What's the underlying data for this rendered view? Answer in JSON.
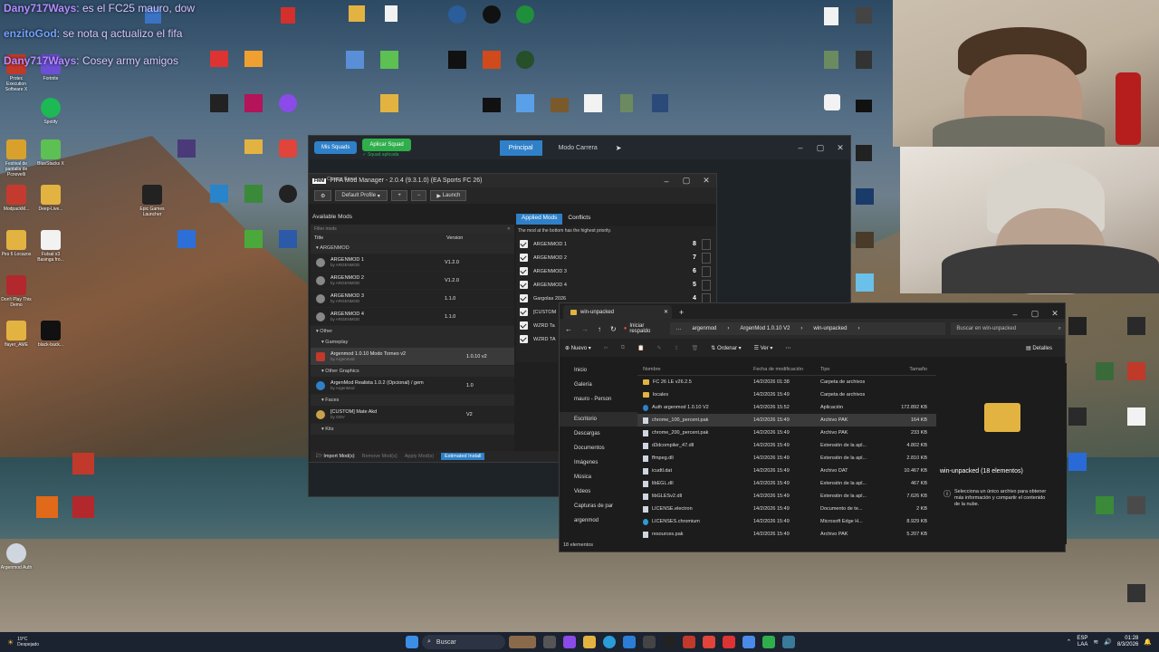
{
  "chat": [
    {
      "user": "Dany717Ways",
      "text": "es el FC25 mauro, dow"
    },
    {
      "user": "enzitoGod",
      "text": "se nota q actualizo el fifa"
    },
    {
      "user": "Dany717Ways",
      "text": "Cosey army amigos"
    }
  ],
  "desktop_icons": [
    {
      "label": "Protec Execution Software X"
    },
    {
      "label": "Fortnite"
    },
    {
      "label": "Spotify"
    },
    {
      "label": "Festival de pantalla de Pcnovelli"
    },
    {
      "label": "BlueStacks X"
    },
    {
      "label": "Epic Games Launcher"
    },
    {
      "label": "ModpackM..."
    },
    {
      "label": "Deep-Live..."
    },
    {
      "label": "Pes 6 Locazos"
    },
    {
      "label": "Futsal x3 Basinga fro..."
    },
    {
      "label": "Don't Play This Demo"
    },
    {
      "label": "flayer_AME"
    },
    {
      "label": "black-back..."
    },
    {
      "label": "Argenmod Auth"
    }
  ],
  "squad_window": {
    "my_squads": "Mis Squads",
    "apply_squad": "Aplicar Squad",
    "squad_applied": "✓ Squad aplicada",
    "tab_main": "Principal",
    "tab_career": "Modo Carrera"
  },
  "fmm": {
    "title": "FIFA Mod Manager - 2.0.4 (9.3.1.0) (EA Sports FC 26)",
    "change_game": "Change Game",
    "profile": "Default Profile",
    "launch": "Launch",
    "available_mods": "Available Mods",
    "filter_placeholder": "Filter mods",
    "col_title": "Title",
    "col_version": "Version",
    "groups": [
      {
        "name": "ARGENMOD",
        "mods": [
          {
            "name": "ARGENMOD 1",
            "by": "by ARGENMOD",
            "version": "V1.2.0"
          },
          {
            "name": "ARGENMOD 2",
            "by": "by ARGENMOD",
            "version": "V1.2.0"
          },
          {
            "name": "ARGENMOD 3",
            "by": "by ARGENMOD",
            "version": "1.1.0"
          },
          {
            "name": "ARGENMOD 4",
            "by": "by ARGENMOD",
            "version": "1.1.0"
          }
        ]
      },
      {
        "name": "Other",
        "mods": []
      },
      {
        "name": "Gameplay",
        "mods": [
          {
            "name": "Argenmod 1.0.10 Modo Torneo v2",
            "by": "by Argenmod",
            "version": "1.0.10 v2"
          }
        ]
      },
      {
        "name": "Other Graphics",
        "mods": [
          {
            "name": "ArgenMod Realista 1.0.2 (Opcional) / gem",
            "by": "by ArgenMod",
            "version": "1.0"
          }
        ]
      },
      {
        "name": "Faces",
        "mods": [
          {
            "name": "[CUSTOM] Mate Akd",
            "by": "by ODV",
            "version": "V2"
          }
        ]
      },
      {
        "name": "Kits",
        "mods": []
      }
    ],
    "import_mods": "Import Mod(s)",
    "remove_mods": "Remove Mod(s)",
    "apply_mods": "Apply Mod(s)",
    "estimated": "Estimated Install",
    "applied_tab": "Applied Mods",
    "conflicts_tab": "Conflicts",
    "priority_note": "The mod at the bottom has the highest priority.",
    "applied": [
      {
        "name": "ARGENMOD 1",
        "priority": "8"
      },
      {
        "name": "ARGENMOD 2",
        "priority": "7"
      },
      {
        "name": "ARGENMOD 3",
        "priority": "6"
      },
      {
        "name": "ARGENMOD 4",
        "priority": "5"
      },
      {
        "name": "Gargolas 2026",
        "priority": "4"
      },
      {
        "name": "[CUSTOM",
        "priority": ""
      },
      {
        "name": "WZRD Ta",
        "priority": ""
      },
      {
        "name": "WZRD TA",
        "priority": ""
      }
    ]
  },
  "explorer": {
    "tab_title": "win-unpacked",
    "backup": "Iniciar respaldo",
    "crumbs": [
      "argenmod",
      "ArgenMod 1.0.10 V2",
      "win-unpacked"
    ],
    "search_placeholder": "Buscar en win-unpacked",
    "new": "Nuevo",
    "sort": "Ordenar",
    "view": "Ver",
    "details": "Detalles",
    "nav": [
      "Inicio",
      "Galería",
      "mauro - Person",
      "Escritorio",
      "Descargas",
      "Documentos",
      "Imágenes",
      "Música",
      "Videos",
      "Capturas de par",
      "argenmod"
    ],
    "cols": [
      "Nombre",
      "Fecha de modificación",
      "Tipo",
      "Tamaño"
    ],
    "files": [
      {
        "name": "FC 26 LE v26.2.5",
        "date": "14/2/2026 01:38",
        "type": "Carpeta de archivos",
        "size": "",
        "kind": "folder"
      },
      {
        "name": "locales",
        "date": "14/2/2026 15:49",
        "type": "Carpeta de archivos",
        "size": "",
        "kind": "folder"
      },
      {
        "name": "Auth argenmod 1.0.10 V2",
        "date": "14/2/2026 15:52",
        "type": "Aplicación",
        "size": "172.892 KB",
        "kind": "app"
      },
      {
        "name": "chrome_100_percent.pak",
        "date": "14/2/2026 15:49",
        "type": "Archivo PAK",
        "size": "164 KB",
        "kind": "file"
      },
      {
        "name": "chrome_200_percent.pak",
        "date": "14/2/2026 15:49",
        "type": "Archivo PAK",
        "size": "233 KB",
        "kind": "file"
      },
      {
        "name": "d3dcompiler_47.dll",
        "date": "14/2/2026 15:49",
        "type": "Extensión de la apl...",
        "size": "4.802 KB",
        "kind": "file"
      },
      {
        "name": "ffmpeg.dll",
        "date": "14/2/2026 15:49",
        "type": "Extensión de la apl...",
        "size": "2.810 KB",
        "kind": "file"
      },
      {
        "name": "icudtl.dat",
        "date": "14/2/2026 15:49",
        "type": "Archivo DAT",
        "size": "10.467 KB",
        "kind": "file"
      },
      {
        "name": "libEGL.dll",
        "date": "14/2/2026 15:49",
        "type": "Extensión de la apl...",
        "size": "467 KB",
        "kind": "file"
      },
      {
        "name": "libGLESv2.dll",
        "date": "14/2/2026 15:49",
        "type": "Extensión de la apl...",
        "size": "7.626 KB",
        "kind": "file"
      },
      {
        "name": "LICENSE.electron",
        "date": "14/2/2026 15:49",
        "type": "Documento de te...",
        "size": "2 KB",
        "kind": "file"
      },
      {
        "name": "LICENSES.chromium",
        "date": "14/2/2026 15:49",
        "type": "Microsoft Edge H...",
        "size": "8.929 KB",
        "kind": "file"
      },
      {
        "name": "resources.pak",
        "date": "14/2/2026 15:49",
        "type": "Archivo PAK",
        "size": "5.207 KB",
        "kind": "file"
      }
    ],
    "details_title": "win-unpacked (18 elementos)",
    "details_hint": "Selecciona un único archivo para obtener más información y compartir el contenido de la nube.",
    "status": "18 elementos"
  },
  "taskbar": {
    "weather_temp": "19°C",
    "weather_desc": "Despejado",
    "search": "Buscar",
    "lang1": "ESP",
    "lang2": "LAA",
    "time": "01:28",
    "date": "8/3/2026"
  },
  "colors": {
    "accent": "#2f80c9",
    "green": "#2fae4b",
    "folder": "#e3b341",
    "taskbar": "#1b2230"
  }
}
